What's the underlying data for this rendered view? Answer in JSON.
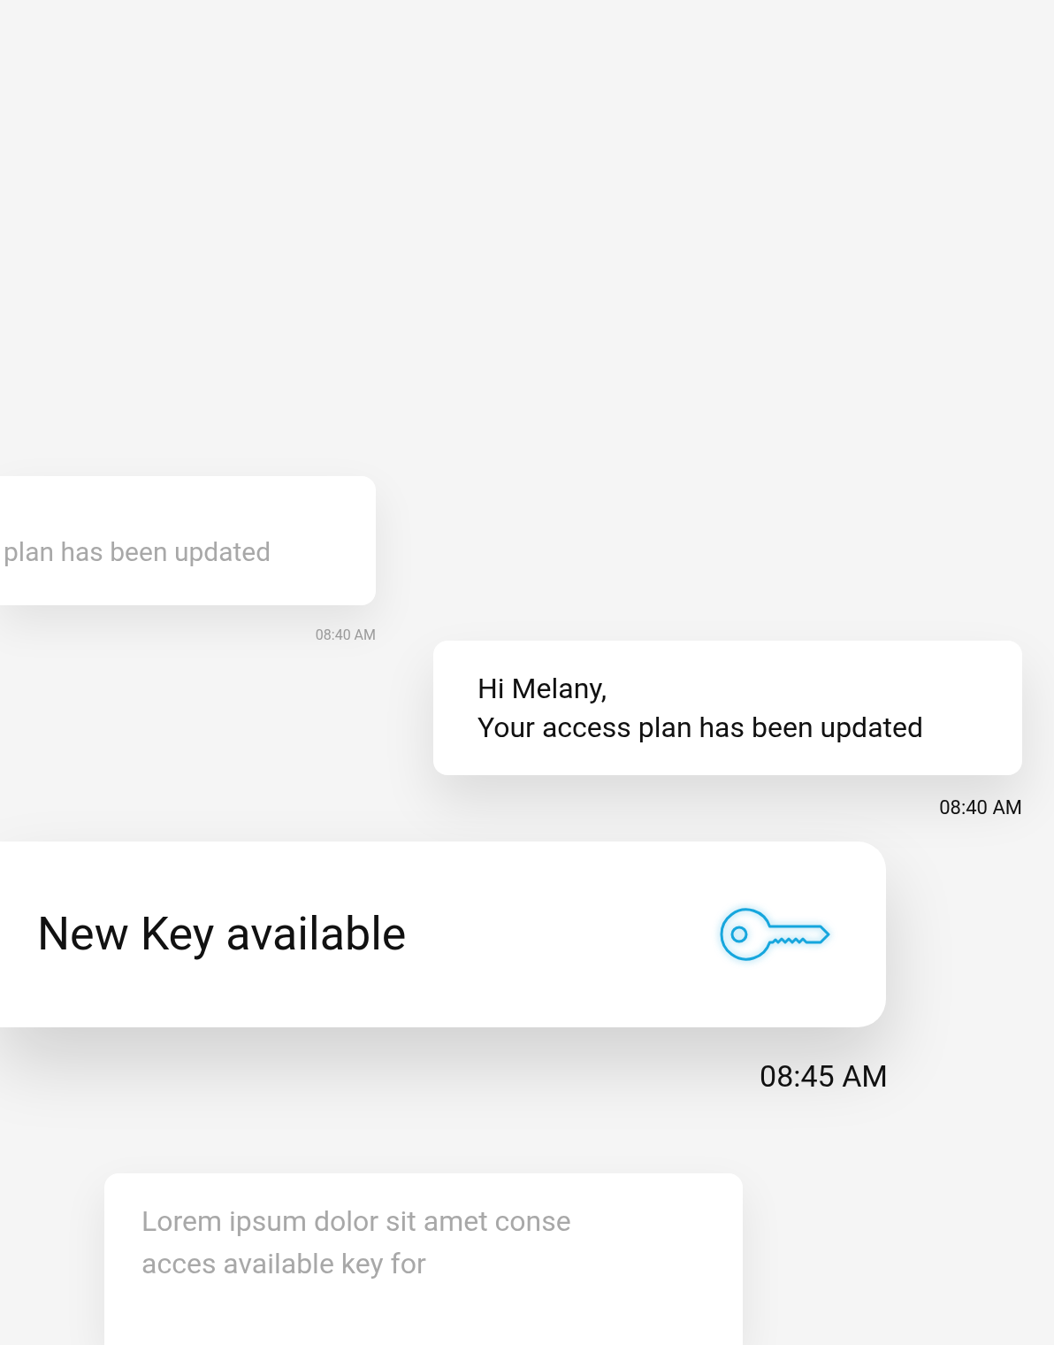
{
  "background_message_top": {
    "text": "plan has been updated",
    "time": "08:40 AM"
  },
  "message": {
    "lines": [
      "Hi Melany,",
      "Your access plan has been updated"
    ],
    "time": "08:40 AM"
  },
  "key_notification": {
    "title": "New Key available",
    "time": "08:45 AM"
  },
  "background_message_bottom": {
    "lines": [
      "Lorem ipsum dolor sit amet conse",
      "acces available key for"
    ]
  }
}
